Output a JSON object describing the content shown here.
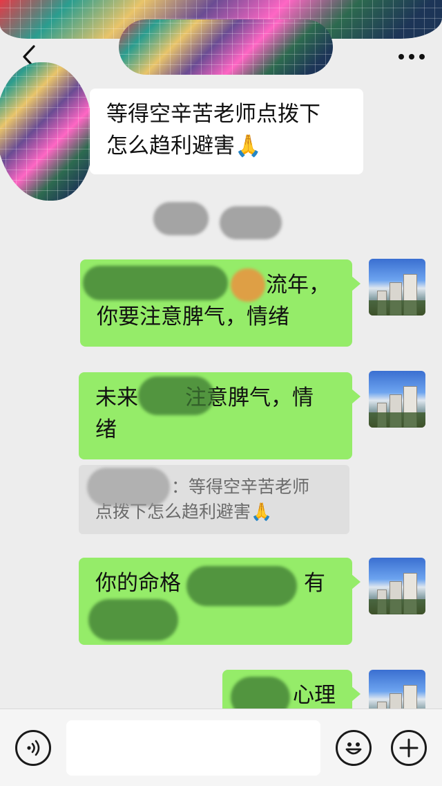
{
  "header": {
    "back_icon": "chevron-left-icon",
    "more_icon": "more-dots-icon"
  },
  "messages": [
    {
      "side": "left",
      "line1": "等得空辛苦老师点拨下",
      "line2": "怎么趋利避害🙏"
    },
    {
      "side": "right",
      "line1": "流年，",
      "line2": "你要注意脾气，情绪"
    },
    {
      "side": "right",
      "line1_a": "未来",
      "line1_b": "注意脾气，情",
      "line2": "绪"
    },
    {
      "side": "right",
      "line1_a": "你的命格",
      "line1_b": "有",
      "line2": ""
    },
    {
      "side": "right",
      "line1": "心理"
    }
  ],
  "quote": {
    "sep": "：",
    "text_a": "等得空辛苦老师",
    "text_b": "点拨下怎么趋利避害🙏"
  },
  "input_bar": {
    "voice_icon": "voice-icon",
    "emoji_icon": "emoji-icon",
    "plus_icon": "plus-icon",
    "input_value": ""
  },
  "colors": {
    "background": "#ededed",
    "bubble_green": "#95ec69",
    "bubble_white": "#ffffff",
    "quote_bg": "#dfdfdf"
  }
}
